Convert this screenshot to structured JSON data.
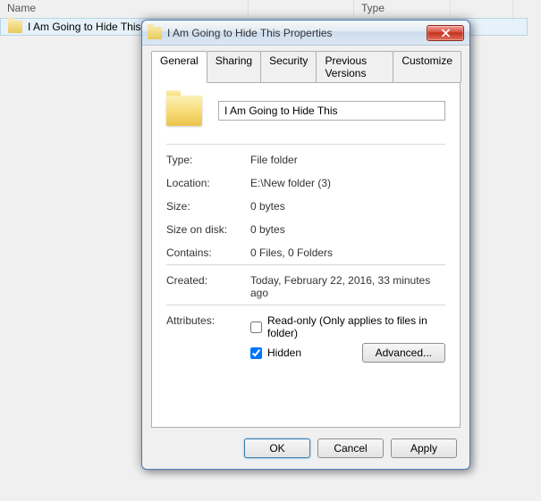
{
  "explorer": {
    "columns": {
      "name": "Name",
      "type": "Type"
    },
    "row_name": "I Am Going to Hide This"
  },
  "titlebar": {
    "title": "I Am Going to Hide This Properties"
  },
  "tabs": {
    "general": "General",
    "sharing": "Sharing",
    "security": "Security",
    "previous": "Previous Versions",
    "customize": "Customize"
  },
  "fields": {
    "name_value": "I Am Going to Hide This",
    "type_label": "Type:",
    "type_value": "File folder",
    "location_label": "Location:",
    "location_value": "E:\\New folder (3)",
    "size_label": "Size:",
    "size_value": "0 bytes",
    "disk_label": "Size on disk:",
    "disk_value": "0 bytes",
    "contains_label": "Contains:",
    "contains_value": "0 Files, 0 Folders",
    "created_label": "Created:",
    "created_value": "Today, February 22, 2016, 33 minutes ago",
    "attributes_label": "Attributes:",
    "readonly_label": "Read-only (Only applies to files in folder)",
    "hidden_label": "Hidden",
    "advanced_label": "Advanced...",
    "readonly_checked": false,
    "hidden_checked": true
  },
  "buttons": {
    "ok": "OK",
    "cancel": "Cancel",
    "apply": "Apply"
  }
}
